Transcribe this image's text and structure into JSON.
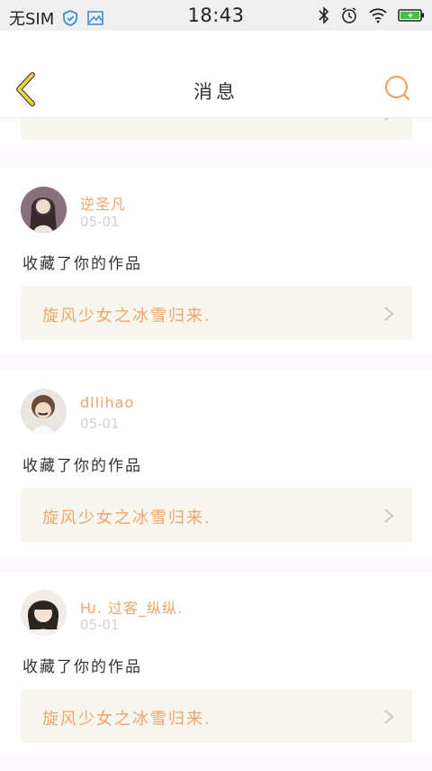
{
  "status_bar": {
    "carrier": "无SIM",
    "time": "18:43"
  },
  "header": {
    "title": "消息"
  },
  "colors": {
    "accent": "#f0a46a",
    "back_icon": "#f5d23c",
    "card_bg": "#f6f6ef",
    "separator": "#fdf8fb"
  },
  "messages": [
    {
      "username": "逆圣凡",
      "date": "05-01",
      "action": "收藏了你的作品",
      "work_title": "旋风少女之冰雪归来."
    },
    {
      "username": "dllihao",
      "date": "05-01",
      "action": "收藏了你的作品",
      "work_title": "旋风少女之冰雪归来."
    },
    {
      "username": "Ƕ. 过客_纵纵.",
      "date": "05-01",
      "action": "收藏了你的作品",
      "work_title": "旋风少女之冰雪归来."
    }
  ]
}
